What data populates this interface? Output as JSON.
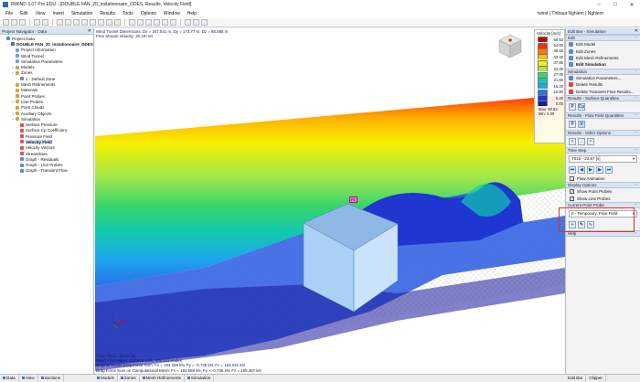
{
  "window": {
    "title": "RWIND 3.07 Pro EDU - [DOUBLE FAN_20_instationnaire_DDES, Results, Velocity Field]",
    "user": "rwind | Thibaut Nghiem | Nghiem"
  },
  "menu": [
    "File",
    "Edit",
    "View",
    "Insert",
    "Simulation",
    "Results",
    "Tools",
    "Options",
    "Window",
    "Help"
  ],
  "navigator": {
    "title": "Project Navigator - Data",
    "items": [
      {
        "label": "Project Data",
        "depth": 0,
        "exp": "",
        "color": "#5b8ac9"
      },
      {
        "label": "DOUBLE FAN_20_instationnaire_DDES",
        "depth": 1,
        "exp": "−",
        "color": "#3d6fb7",
        "bold": true
      },
      {
        "label": "Project Information",
        "depth": 2,
        "exp": "",
        "color": "#7aa0d6"
      },
      {
        "label": "Wind Tunnel",
        "depth": 2,
        "exp": "",
        "color": "#7aa0d6"
      },
      {
        "label": "Simulation Parameters",
        "depth": 2,
        "exp": "",
        "color": "#7aa0d6"
      },
      {
        "label": "Models",
        "depth": 2,
        "exp": "+",
        "color": "#d1a545"
      },
      {
        "label": "Zones",
        "depth": 2,
        "exp": "−",
        "color": "#d1a545"
      },
      {
        "label": "1 - Default Zone",
        "depth": 3,
        "exp": "",
        "color": "#888"
      },
      {
        "label": "Mesh Refinements",
        "depth": 2,
        "exp": "",
        "color": "#d1a545"
      },
      {
        "label": "Materials",
        "depth": 2,
        "exp": "",
        "color": "#d1a545"
      },
      {
        "label": "Point Probes",
        "depth": 2,
        "exp": "",
        "color": "#d1a545"
      },
      {
        "label": "Line Probes",
        "depth": 2,
        "exp": "+",
        "color": "#d1a545"
      },
      {
        "label": "Point Clouds",
        "depth": 2,
        "exp": "",
        "color": "#d1a545"
      },
      {
        "label": "Auxiliary Objects",
        "depth": 2,
        "exp": "+",
        "color": "#d1a545"
      },
      {
        "label": "Simulation",
        "depth": 2,
        "exp": "−",
        "color": "#d1a545"
      },
      {
        "label": "Surface Pressure",
        "depth": 3,
        "exp": "",
        "color": "#e15050"
      },
      {
        "label": "Surface Cp Coefficient",
        "depth": 3,
        "exp": "",
        "color": "#e15050"
      },
      {
        "label": "Pressure Field",
        "depth": 3,
        "exp": "",
        "color": "#e15050"
      },
      {
        "label": "Velocity Field",
        "depth": 3,
        "exp": "",
        "color": "#e15050",
        "selected": true
      },
      {
        "label": "Velocity Vectors",
        "depth": 3,
        "exp": "",
        "color": "#e15050"
      },
      {
        "label": "Streamlines",
        "depth": 3,
        "exp": "",
        "color": "#e15050"
      },
      {
        "label": "Graph - Residuals",
        "depth": 3,
        "exp": "",
        "color": "#5b8ac9"
      },
      {
        "label": "Graph - Line Probes",
        "depth": 3,
        "exp": "",
        "color": "#5b8ac9"
      },
      {
        "label": "Graph - Transient Flow",
        "depth": 3,
        "exp": "",
        "color": "#5b8ac9"
      }
    ],
    "tabs": [
      "Data",
      "View",
      "Sections"
    ]
  },
  "view": {
    "info_top": [
      "Wind Tunnel Dimensions: Dx = 347.541 m, Dy = 173.77 m, Dz = 86.885 m",
      "Free Stream Velocity: 30.19 m/s"
    ],
    "info_bottom": [
      "Time: T015 - 23.67 [s]",
      "Mesh Information: 522 618 cells, 605 122 nodes",
      "Original Model Drag Force Sum: Fx = 194 259 kN, Fy = -0.735 kN, Fz = 164.031 kN",
      "Drag Force Sum on Computational Mesh: Fx = 192 559 kN, Fy = -0.736 kN, Fz = 165.367 kN"
    ],
    "probe_label": "P1",
    "tabs": [
      "Models",
      "Zones",
      "Mesh Refinements",
      "Simulation"
    ]
  },
  "legend": {
    "title": "Velocity [m/s]",
    "values": [
      "60.53",
      "54.00",
      "48.60",
      "43.20",
      "37.80",
      "32.40",
      "27.00",
      "21.60",
      "16.20",
      "10.80",
      "5.40",
      "0.00"
    ],
    "colors": [
      "#c00000",
      "#ff2a00",
      "#ff7a00",
      "#ffc000",
      "#f6f000",
      "#a8e84a",
      "#37d66a",
      "#10c9b0",
      "#1ea6ef",
      "#2a6fe8",
      "#1f37d0",
      "#1a1a9c"
    ],
    "max": "Max: 60.53",
    "min": "Min: 0.00"
  },
  "right_panel": {
    "title": "Edit Bar - Simulation",
    "sections": {
      "edit": "Edit",
      "edit_items": [
        "Edit Model",
        "Edit Zones",
        "Edit Mesh Refinements",
        "Edit Simulation"
      ],
      "simulation": "Simulation",
      "sim_items": [
        "Simulation Parameters...",
        "Delete Results",
        "Delete Transient Flow Results..."
      ],
      "surface": "Results - Surface Quantities",
      "surface_btns": [
        "P",
        "Cp"
      ],
      "flow": "Results - Flow Field Quantities",
      "flow_btns": [
        "P",
        "V"
      ],
      "other": "Results - Other Options",
      "time": "Time Step",
      "time_value": "T015 - 23.67 [s]",
      "flow_anim": "Flow Animation",
      "display": "Display Options",
      "show_point": "Show Point Probes",
      "show_line": "Show Line Probes",
      "current_probe": "Current Point Probe",
      "probe_value": "0 - Temporary, Flow Field",
      "help": "Help"
    },
    "tabs": [
      "Edit Bar",
      "Clipper"
    ]
  }
}
